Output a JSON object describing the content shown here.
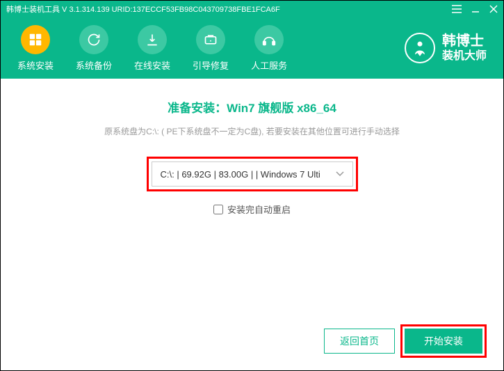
{
  "titlebar": {
    "text": "韩博士装机工具 V 3.1.314.139 URID:137ECCF53FB98C043709738FBE1FCA6F"
  },
  "nav": {
    "items": [
      {
        "label": "系统安装",
        "icon": "install"
      },
      {
        "label": "系统备份",
        "icon": "backup"
      },
      {
        "label": "在线安装",
        "icon": "online"
      },
      {
        "label": "引导修复",
        "icon": "repair"
      },
      {
        "label": "人工服务",
        "icon": "service"
      }
    ]
  },
  "logo": {
    "main": "韩博士",
    "sub": "装机大师"
  },
  "main": {
    "title": "准备安装：Win7 旗舰版 x86_64",
    "hint": "原系统盘为C:\\: ( PE下系统盘不一定为C盘), 若要安装在其他位置可进行手动选择",
    "drive_selected": "C:\\: | 69.92G | 83.00G |  | Windows 7 Ulti",
    "checkbox_label": "安装完自动重启"
  },
  "footer": {
    "back_label": "返回首页",
    "start_label": "开始安装"
  },
  "colors": {
    "primary": "#0ab78b",
    "accent": "#ffb700",
    "highlight": "#f00"
  }
}
